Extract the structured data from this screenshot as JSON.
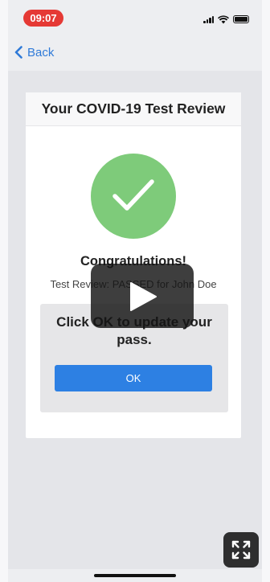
{
  "status_bar": {
    "time": "09:07",
    "icons": [
      "signal-icon",
      "wifi-icon",
      "battery-icon"
    ],
    "time_pill_color": "#e53935"
  },
  "nav": {
    "back_label": "Back",
    "back_icon": "chevron-left-icon",
    "accent_color": "#2f7ad8"
  },
  "card": {
    "title": "Your COVID-19 Test Review",
    "status_icon": "checkmark-icon",
    "status_color": "#7ecb7a",
    "heading": "Congratulations!",
    "review_text": "Test Review: PASSED for John Doe",
    "prompt": "Click OK to update your pass.",
    "ok_label": "OK",
    "ok_color": "#2d80e3"
  },
  "video_overlay": {
    "play_icon": "play-icon",
    "fullscreen_icon": "fullscreen-icon"
  }
}
